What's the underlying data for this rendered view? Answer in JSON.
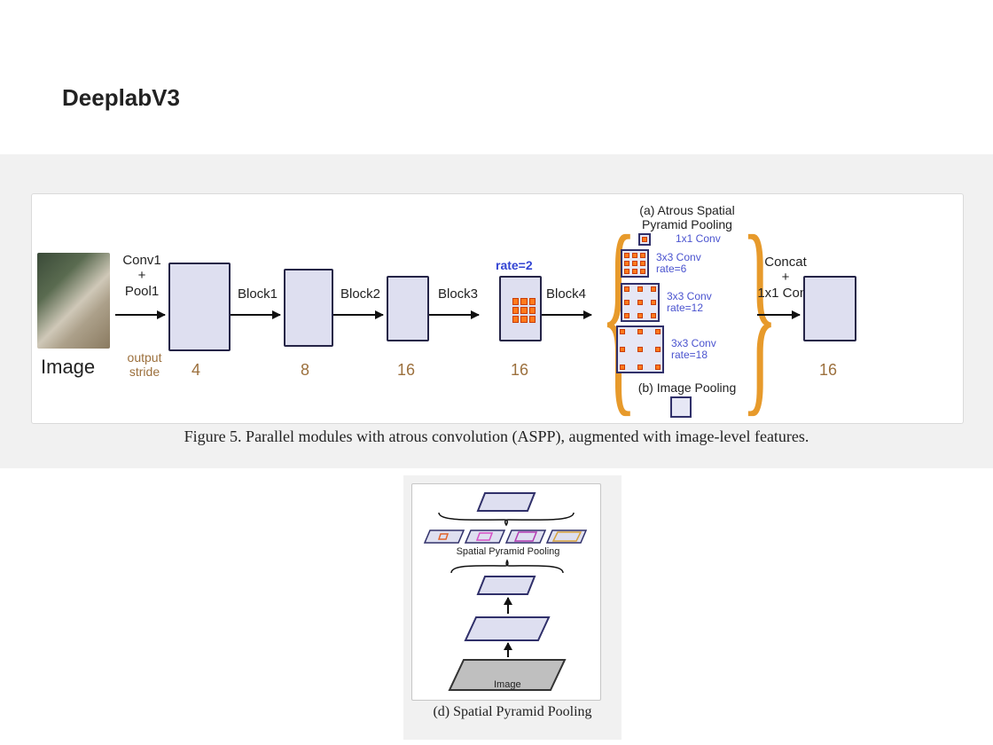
{
  "title": "DeeplabV3",
  "fig1": {
    "image_label": "Image",
    "conv_pool": "Conv1\n+\nPool1",
    "blocks": [
      "Block1",
      "Block2",
      "Block3",
      "Block4"
    ],
    "output_stride_label": "output\nstride",
    "output_strides": [
      "4",
      "8",
      "16",
      "16",
      "16"
    ],
    "rate2": "rate=2",
    "aspp_title": "(a) Atrous Spatial\nPyramid Pooling",
    "aspp_items": [
      "1x1 Conv",
      "3x3 Conv\nrate=6",
      "3x3 Conv\nrate=12",
      "3x3 Conv\nrate=18"
    ],
    "image_pooling": "(b) Image Pooling",
    "concat": "Concat\n+\n1x1 Conv",
    "caption": "Figure 5. Parallel modules with atrous convolution (ASPP), augmented with image-level features."
  },
  "fig2": {
    "spp": "Spatial Pyramid Pooling",
    "image": "Image",
    "caption": "(d) Spatial Pyramid Pooling"
  }
}
